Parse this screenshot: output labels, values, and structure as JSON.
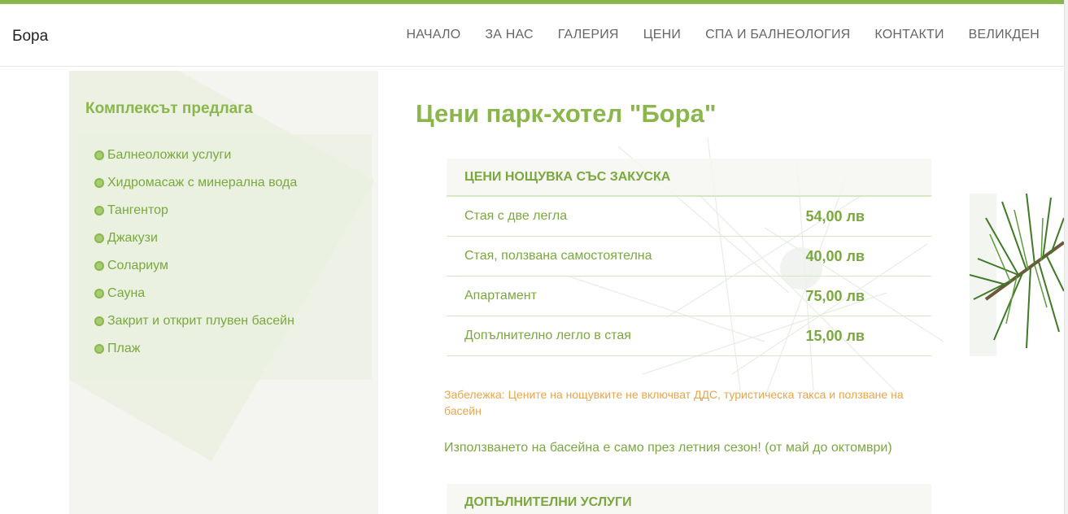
{
  "header": {
    "brand": "Бора",
    "nav": [
      {
        "label": "НАЧАЛО"
      },
      {
        "label": "ЗА НАС"
      },
      {
        "label": "ГАЛЕРИЯ"
      },
      {
        "label": "ЦЕНИ"
      },
      {
        "label": "СПА И БАЛНЕОЛОГИЯ"
      },
      {
        "label": "КОНТАКТИ"
      },
      {
        "label": "ВЕЛИКДЕН"
      }
    ]
  },
  "sidebar": {
    "title": "Комплексът предлага",
    "items": [
      {
        "label": "Балнеоложки услуги"
      },
      {
        "label": "Хидромасаж с минерална вода"
      },
      {
        "label": "Тангентор"
      },
      {
        "label": "Джакузи"
      },
      {
        "label": "Солариум"
      },
      {
        "label": "Сауна"
      },
      {
        "label": "Закрит и открит плувен басейн"
      },
      {
        "label": "Плаж"
      }
    ]
  },
  "main": {
    "title": "Цени парк-хотел \"Бора\"",
    "price_table": {
      "heading": "ЦЕНИ НОЩУВКА СЪС ЗАКУСКА",
      "rows": [
        {
          "label": "Стая с две легла",
          "price": "54,00 лв"
        },
        {
          "label": "Стая, ползвана самостоятелна",
          "price": "40,00 лв"
        },
        {
          "label": "Апартамент",
          "price": "75,00 лв"
        },
        {
          "label": "Допълнително легло в стая",
          "price": "15,00 лв"
        }
      ]
    },
    "note": "Забележка: Цените на нощувките не включват ДДС, туристическа такса и ползване на басейн",
    "pool_note": "Използването на басейна е само през летния сезон! (от май до октомври)",
    "extra_table": {
      "heading": "ДОПЪЛНИТЕЛНИ УСЛУГИ"
    }
  },
  "colors": {
    "accent": "#8ab64b",
    "text_green": "#7aa83e",
    "note_orange": "#e8a54a",
    "sidebar_bg": "#f4f4f0"
  }
}
